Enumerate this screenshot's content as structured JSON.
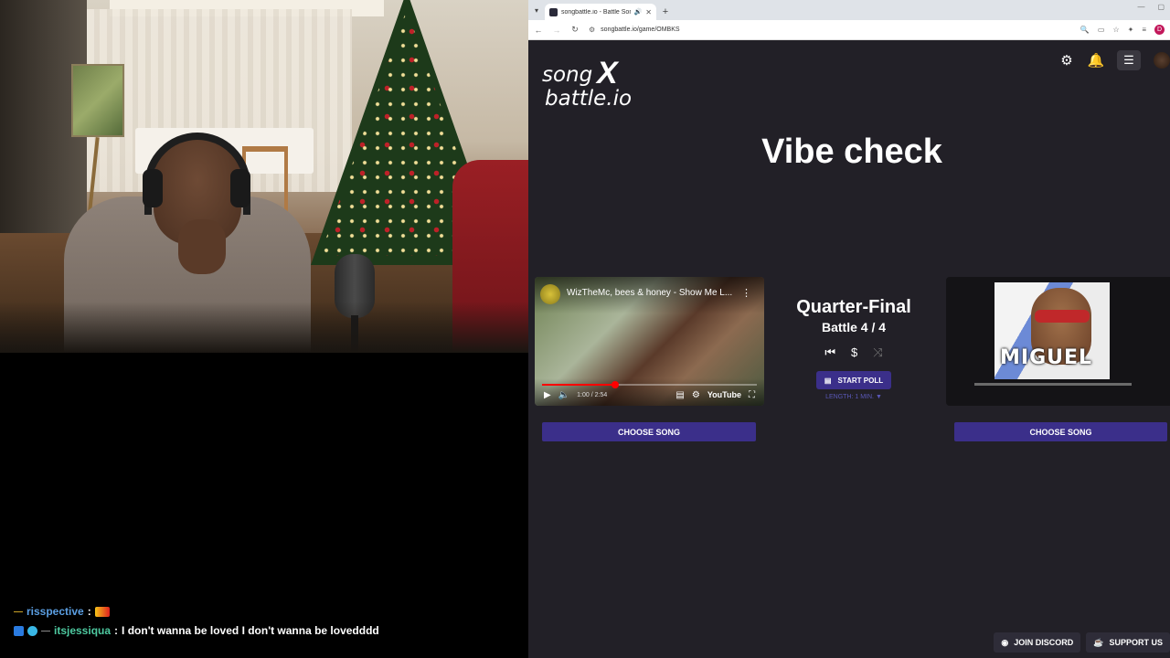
{
  "chat": {
    "messages": [
      {
        "user": "risspective",
        "text": ""
      },
      {
        "user": "itsjessiqua",
        "text": "I don't wanna be loved I don't wanna be lovedddd"
      }
    ]
  },
  "browser": {
    "tab_title": "songbattle.io - Battle Songs",
    "url": "songbattle.io/game/OMBKS",
    "profile_initial": "D"
  },
  "page": {
    "logo_song": "song",
    "logo_battle": "battle.io",
    "heading": "Vibe check",
    "left_video": {
      "title": "WizTheMc, bees & honey - Show Me L...",
      "time": "1:00 / 2:54",
      "progress": 0.34,
      "platform": "YouTube"
    },
    "round": "Quarter-Final",
    "battle": "Battle 4 / 4",
    "start_poll": "START POLL",
    "poll_length": "LENGTH: 1 MIN. ▼",
    "right_album_text": "MIGUEL",
    "choose_song_left": "CHOOSE SONG",
    "choose_song_right": "CHOOSE SONG",
    "join_discord": "JOIN DISCORD",
    "support": "SUPPORT US"
  },
  "colors": {
    "accent": "#3b2f8a",
    "page_bg": "#222027",
    "yt_red": "#ff0000"
  }
}
